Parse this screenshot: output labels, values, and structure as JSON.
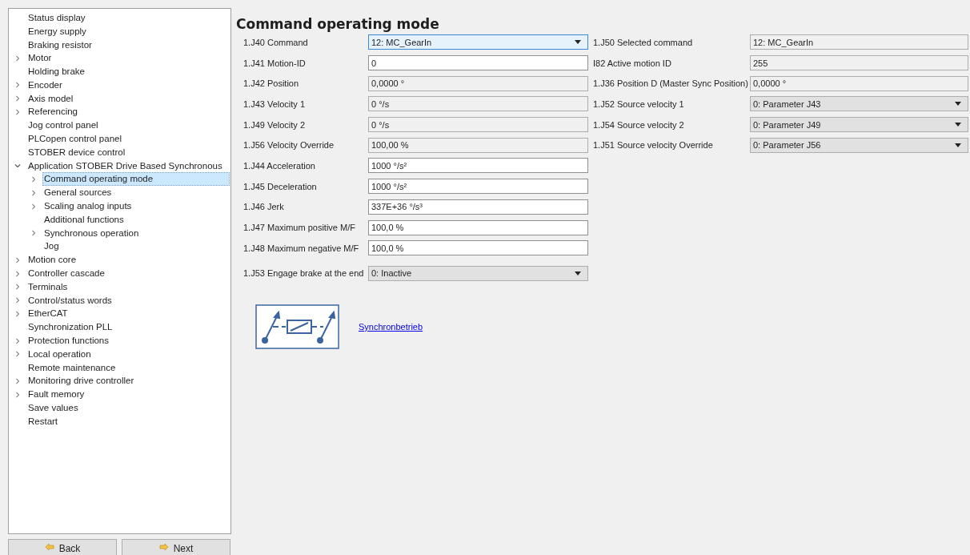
{
  "tree": [
    {
      "label": "Status display"
    },
    {
      "label": "Energy supply"
    },
    {
      "label": "Braking resistor"
    },
    {
      "label": "Motor",
      "expanded": false
    },
    {
      "label": "Holding brake"
    },
    {
      "label": "Encoder",
      "expanded": false
    },
    {
      "label": "Axis model",
      "expanded": false
    },
    {
      "label": "Referencing",
      "expanded": false
    },
    {
      "label": "Jog control panel"
    },
    {
      "label": "PLCopen control panel"
    },
    {
      "label": "STOBER device control"
    },
    {
      "label": "Application STOBER Drive Based Synchronous",
      "expanded": true,
      "children": [
        {
          "label": "Command operating mode",
          "expanded": false,
          "selected": true
        },
        {
          "label": "General sources",
          "expanded": false,
          "selected": false
        },
        {
          "label": "Scaling analog inputs",
          "expanded": false,
          "selected": false
        },
        {
          "label": "Additional functions",
          "selected": false
        },
        {
          "label": "Synchronous operation",
          "expanded": false,
          "selected": false
        },
        {
          "label": "Jog",
          "selected": false
        }
      ]
    },
    {
      "label": "Motion core",
      "expanded": false
    },
    {
      "label": "Controller cascade",
      "expanded": false
    },
    {
      "label": "Terminals",
      "expanded": false
    },
    {
      "label": "Control/status words",
      "expanded": false
    },
    {
      "label": "EtherCAT",
      "expanded": false
    },
    {
      "label": "Synchronization PLL"
    },
    {
      "label": "Protection functions",
      "expanded": false
    },
    {
      "label": "Local operation",
      "expanded": false
    },
    {
      "label": "Remote maintenance"
    },
    {
      "label": "Monitoring drive controller",
      "expanded": false
    },
    {
      "label": "Fault memory",
      "expanded": false
    },
    {
      "label": "Save values"
    },
    {
      "label": "Restart"
    }
  ],
  "buttons": [
    {
      "label": "Back"
    },
    {
      "label": "Next"
    }
  ],
  "title": "Command operating mode",
  "left_params": [
    {
      "label": "1.J40 Command",
      "value": "12: MC_GearIn",
      "kind": "dropdown",
      "focused": true
    },
    {
      "label": "1.J41 Motion-ID",
      "value": "0",
      "kind": "input"
    },
    {
      "label": "1.J42 Position",
      "value": "0,0000 °",
      "kind": "readonly"
    },
    {
      "label": "1.J43 Velocity 1",
      "value": "0 °/s",
      "kind": "readonly"
    },
    {
      "label": "1.J49 Velocity 2",
      "value": "0 °/s",
      "kind": "readonly"
    },
    {
      "label": "1.J56 Velocity Override",
      "value": "100,00 %",
      "kind": "readonly"
    },
    {
      "label": "1.J44 Acceleration",
      "value": "1000 °/s²",
      "kind": "input"
    },
    {
      "label": "1.J45 Deceleration",
      "value": "1000 °/s²",
      "kind": "input"
    },
    {
      "label": "1.J46 Jerk",
      "value": "337E+36 °/s³",
      "kind": "input"
    },
    {
      "label": "1.J47 Maximum positive M/F",
      "value": "100,0 %",
      "kind": "input"
    },
    {
      "label": "1.J48 Maximum negative M/F",
      "value": "100,0 %",
      "kind": "input"
    },
    {
      "label": "1.J53 Engage brake at the end",
      "value": "0: Inactive",
      "kind": "dropdown",
      "focused": false
    }
  ],
  "right_params": [
    {
      "label": "1.J50 Selected command",
      "value": "12: MC_GearIn",
      "kind": "readonly"
    },
    {
      "label": "I82 Active motion ID",
      "value": "255",
      "kind": "readonly"
    },
    {
      "label": "1.J36 Position D (Master Sync Position)",
      "value": "0,0000 °",
      "kind": "readonly"
    },
    {
      "label": "1.J52 Source velocity 1",
      "value": "0: Parameter J43",
      "kind": "dropdown",
      "focused": false
    },
    {
      "label": "1.J54 Source velocity 2",
      "value": "0: Parameter J49",
      "kind": "dropdown",
      "focused": false
    },
    {
      "label": "1.J51 Source velocity Override",
      "value": "0: Parameter J56",
      "kind": "dropdown",
      "focused": false
    }
  ],
  "link": "Synchronbetrieb"
}
